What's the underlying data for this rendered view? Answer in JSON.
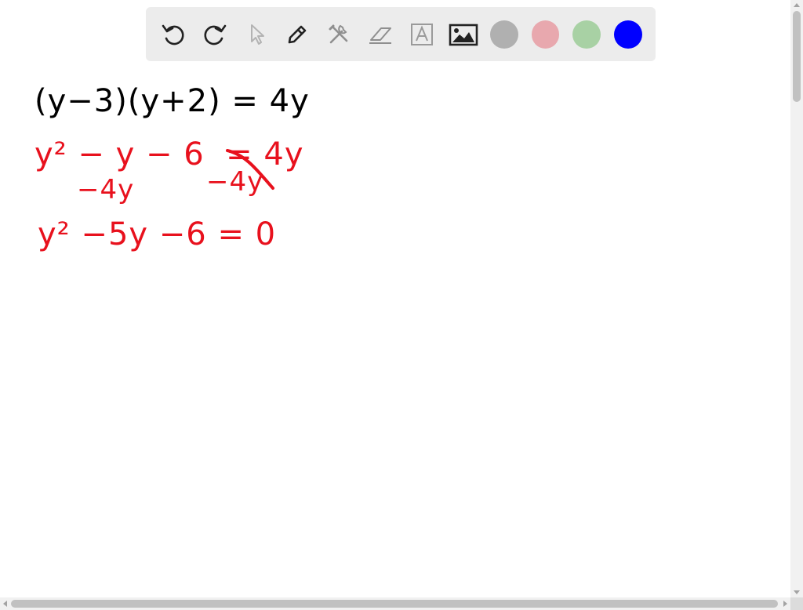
{
  "toolbar": {
    "tools": [
      {
        "name": "undo",
        "icon": "undo-icon"
      },
      {
        "name": "redo",
        "icon": "redo-icon"
      },
      {
        "name": "select",
        "icon": "cursor-icon"
      },
      {
        "name": "pen",
        "icon": "pencil-icon"
      },
      {
        "name": "tools",
        "icon": "tools-icon"
      },
      {
        "name": "eraser",
        "icon": "eraser-icon"
      },
      {
        "name": "text",
        "icon": "text-icon"
      },
      {
        "name": "image",
        "icon": "image-icon"
      }
    ],
    "colors": [
      "#b0b0b0",
      "#e8a8ae",
      "#a8d1a4",
      "#0000ff"
    ]
  },
  "canvas": {
    "lines": [
      {
        "text": "(y−3)(y+2) = 4y",
        "color": "#000000"
      },
      {
        "text": "y² − y − 6  = 4y",
        "color": "#e8111d"
      },
      {
        "text": "−4y",
        "color": "#e8111d"
      },
      {
        "text": "−4y",
        "color": "#e8111d"
      },
      {
        "text": "y² −5y −6 = 0",
        "color": "#e8111d"
      }
    ]
  }
}
